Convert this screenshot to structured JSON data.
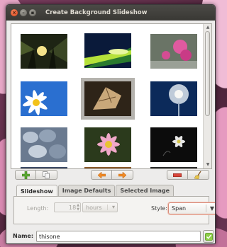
{
  "window": {
    "title": "Create Background Slideshow"
  },
  "gallery": {
    "thumbnails": [
      {
        "name": "forest-sunlight-photo"
      },
      {
        "name": "green-light-tunnel-photo"
      },
      {
        "name": "pink-flowers-photo"
      },
      {
        "name": "white-daisy-blue-sky-photo"
      },
      {
        "name": "dry-leaves-photo"
      },
      {
        "name": "dandelion-seedhead-photo"
      },
      {
        "name": "pebbles-photo"
      },
      {
        "name": "pink-daisy-photo"
      },
      {
        "name": "white-flower-dark-photo"
      }
    ],
    "selected_index": 4
  },
  "toolbar": {
    "add_icon": "plus-icon",
    "copy_icon": "copy-icon",
    "back_icon": "arrow-left-icon",
    "forward_icon": "arrow-right-icon",
    "remove_icon": "minus-icon",
    "clear_icon": "broom-icon"
  },
  "tabs": [
    {
      "label": "Slideshow",
      "active": true
    },
    {
      "label": "Image Defaults",
      "active": false
    },
    {
      "label": "Selected Image",
      "active": false
    }
  ],
  "slideshow": {
    "length_label": "Length:",
    "length_value": "18",
    "length_unit": "hours",
    "style_label": "Style:",
    "style_value": "Span"
  },
  "name_row": {
    "label": "Name:",
    "value": "thisone"
  },
  "colors": {
    "accent_green": "#5aa832",
    "accent_orange": "#f08a24",
    "accent_red": "#d8453a",
    "titlebar": "#3c3b37"
  }
}
